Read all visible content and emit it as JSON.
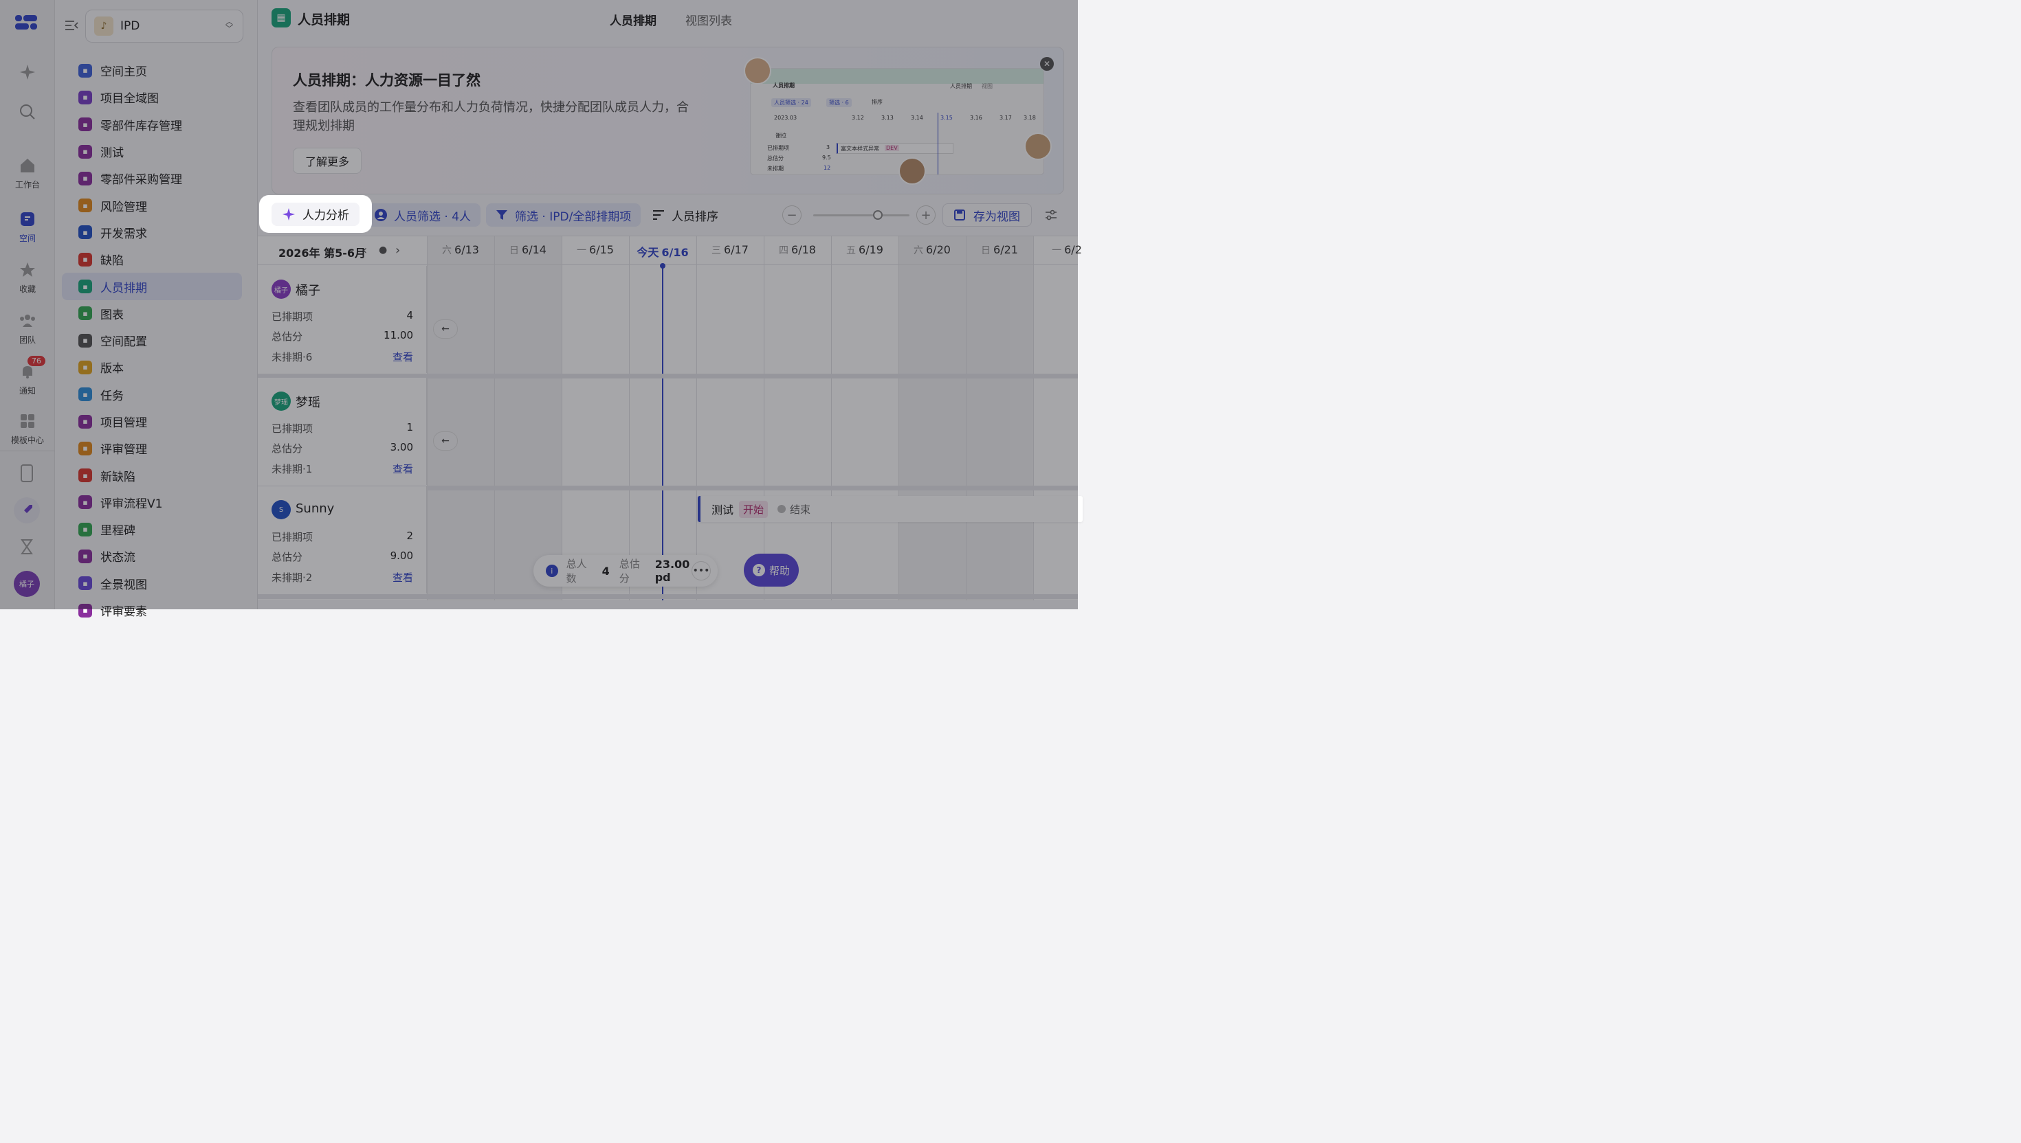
{
  "rail": {
    "items": [
      {
        "label": ""
      },
      {
        "label": ""
      },
      {
        "label": "工作台"
      },
      {
        "label": "空间"
      },
      {
        "label": "收藏"
      },
      {
        "label": "团队"
      },
      {
        "label": "通知"
      },
      {
        "label": "模板中心"
      }
    ],
    "notification_count": "76",
    "user_avatar": "橘子"
  },
  "sidebar": {
    "space_name": "IPD",
    "items": [
      {
        "label": "空间主页",
        "color": "#3f63d8"
      },
      {
        "label": "项目全域图",
        "color": "#7a3fc7"
      },
      {
        "label": "零部件库存管理",
        "color": "#8b2f9e"
      },
      {
        "label": "测试",
        "color": "#8b2f9e"
      },
      {
        "label": "零部件采购管理",
        "color": "#8b2f9e"
      },
      {
        "label": "风险管理",
        "color": "#e08a1e"
      },
      {
        "label": "开发需求",
        "color": "#2553c5"
      },
      {
        "label": "缺陷",
        "color": "#d9372f"
      },
      {
        "label": "人员排期",
        "color": "#1aa67d"
      },
      {
        "label": "图表",
        "color": "#34a853"
      },
      {
        "label": "空间配置",
        "color": "#555555"
      },
      {
        "label": "版本",
        "color": "#e0a521"
      },
      {
        "label": "任务",
        "color": "#2f8fd8"
      },
      {
        "label": "项目管理",
        "color": "#8b2f9e"
      },
      {
        "label": "评审管理",
        "color": "#e08a1e"
      },
      {
        "label": "新缺陷",
        "color": "#d9372f"
      },
      {
        "label": "评审流程V1",
        "color": "#8b2f9e"
      },
      {
        "label": "里程碑",
        "color": "#34a853"
      },
      {
        "label": "状态流",
        "color": "#8b2f9e"
      },
      {
        "label": "全景视图",
        "color": "#6a4bd8"
      },
      {
        "label": "评审要素",
        "color": "#8b2f9e"
      }
    ]
  },
  "header": {
    "title": "人员排期",
    "tabs": [
      {
        "label": "人员排期"
      },
      {
        "label": "视图列表"
      }
    ]
  },
  "banner": {
    "title": "人员排期：人力资源一目了然",
    "description": "查看团队成员的工作量分布和人力负荷情况，快捷分配团队成员人力，合理规划排期",
    "button": "了解更多",
    "preview": {
      "title": "人员排期",
      "tab": "人员排期",
      "tab2": "视图",
      "people_filter": "人员筛选 · 24",
      "filter": "筛选 · 6",
      "sort": "排序",
      "date": "2023.03",
      "person": "谢拉",
      "scheduled": "已排期项",
      "scheduled_v": "3",
      "estimate": "总估分",
      "estimate_v": "9.5",
      "unscheduled": "未排期",
      "unscheduled_v": "12",
      "task": "富文本样式异常",
      "task_tag": "DEV",
      "days": [
        "3.12",
        "3.13",
        "3.14",
        "3.15",
        "3.16",
        "3.17",
        "3.18"
      ]
    }
  },
  "toolbar": {
    "ai_analysis": "人力分析",
    "people_filter": "人员筛选 · 4人",
    "filter": "筛选 · IPD/全部排期项",
    "sort": "人员排序",
    "save_view": "存为视图"
  },
  "grid": {
    "period": "2026年 第5-6月",
    "days": [
      {
        "wk": "六",
        "date": "6/13",
        "weekend": true
      },
      {
        "wk": "日",
        "date": "6/14",
        "weekend": true
      },
      {
        "wk": "一",
        "date": "6/15",
        "weekend": false
      },
      {
        "wk": "今天",
        "date": "6/16",
        "weekend": false,
        "today": true
      },
      {
        "wk": "三",
        "date": "6/17",
        "weekend": false
      },
      {
        "wk": "四",
        "date": "6/18",
        "weekend": false
      },
      {
        "wk": "五",
        "date": "6/19",
        "weekend": false
      },
      {
        "wk": "六",
        "date": "6/20",
        "weekend": true
      },
      {
        "wk": "日",
        "date": "6/21",
        "weekend": true
      },
      {
        "wk": "一",
        "date": "6/2",
        "weekend": false
      }
    ],
    "people": [
      {
        "avatar": "橘子",
        "name": "橘子",
        "color": "#8b3fc7",
        "scheduled_label": "已排期项",
        "scheduled": "4",
        "estimate_label": "总估分",
        "estimate": "11.00",
        "unscheduled_label": "未排期·6",
        "view": "查看"
      },
      {
        "avatar": "梦瑶",
        "name": "梦瑶",
        "color": "#1aa67d",
        "scheduled_label": "已排期项",
        "scheduled": "1",
        "estimate_label": "总估分",
        "estimate": "3.00",
        "unscheduled_label": "未排期·1",
        "view": "查看"
      },
      {
        "avatar": "S",
        "name": "Sunny",
        "color": "#2553c5",
        "scheduled_label": "已排期项",
        "scheduled": "2",
        "estimate_label": "总估分",
        "estimate": "9.00",
        "unscheduled_label": "未排期·2",
        "view": "查看"
      }
    ],
    "task": {
      "name": "测试",
      "start": "开始",
      "end": "结束"
    }
  },
  "summary": {
    "people_label": "总人数",
    "people_count": "4",
    "estimate_label": "总估分",
    "estimate_value": "23.00 pd"
  },
  "help": {
    "label": "帮助"
  }
}
